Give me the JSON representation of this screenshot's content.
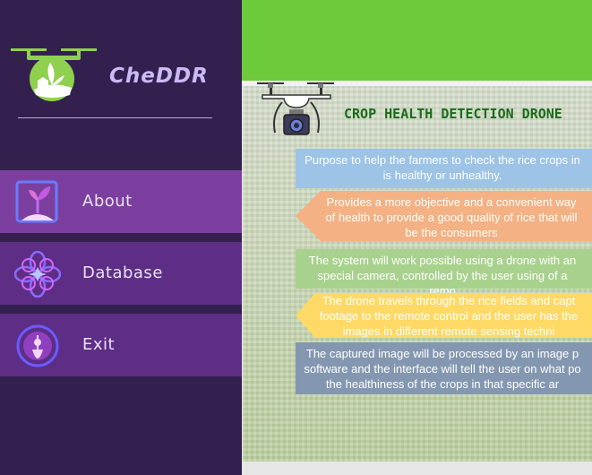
{
  "app": {
    "name": "CheDDR",
    "colors": {
      "sidebar": "#33204f",
      "nav_item": "#5e2e86",
      "nav_active": "#7c3f9f",
      "topbar": "#6dca3a",
      "title": "#1a6b1a"
    }
  },
  "sidebar": {
    "logo_icon": "drone-plant-logo-icon",
    "items": [
      {
        "label": "About",
        "icon": "plant-sprout-icon",
        "active": true
      },
      {
        "label": "Database",
        "icon": "flower-icon",
        "active": false
      },
      {
        "label": "Exit",
        "icon": "location-pin-exit-icon",
        "active": false
      }
    ]
  },
  "main": {
    "title": "CROP HEALTH DETECTION DRONE",
    "header_icon": "drone-camera-icon",
    "banners": [
      {
        "text": "Purpose to help the farmers to check the rice crops in is healthy or unhealthy.",
        "color": "#9dc3e6"
      },
      {
        "text": "Provides a more objective and a convenient way of health to provide a good quality of rice that will be the consumers",
        "color": "#f4b183"
      },
      {
        "text": "The system will work possible using a drone with an special camera, controlled by the user using of a remo",
        "color": "#a9d18e"
      },
      {
        "text": "The drone travels through the rice fields and capt footage to the remote control and the user has the images in different remote sensing techni",
        "color": "#ffd966"
      },
      {
        "text": "The captured image will be processed by an image p software and the interface will tell the user on what po the healthiness of the crops in that specific ar",
        "color": "#8497b0"
      }
    ]
  }
}
